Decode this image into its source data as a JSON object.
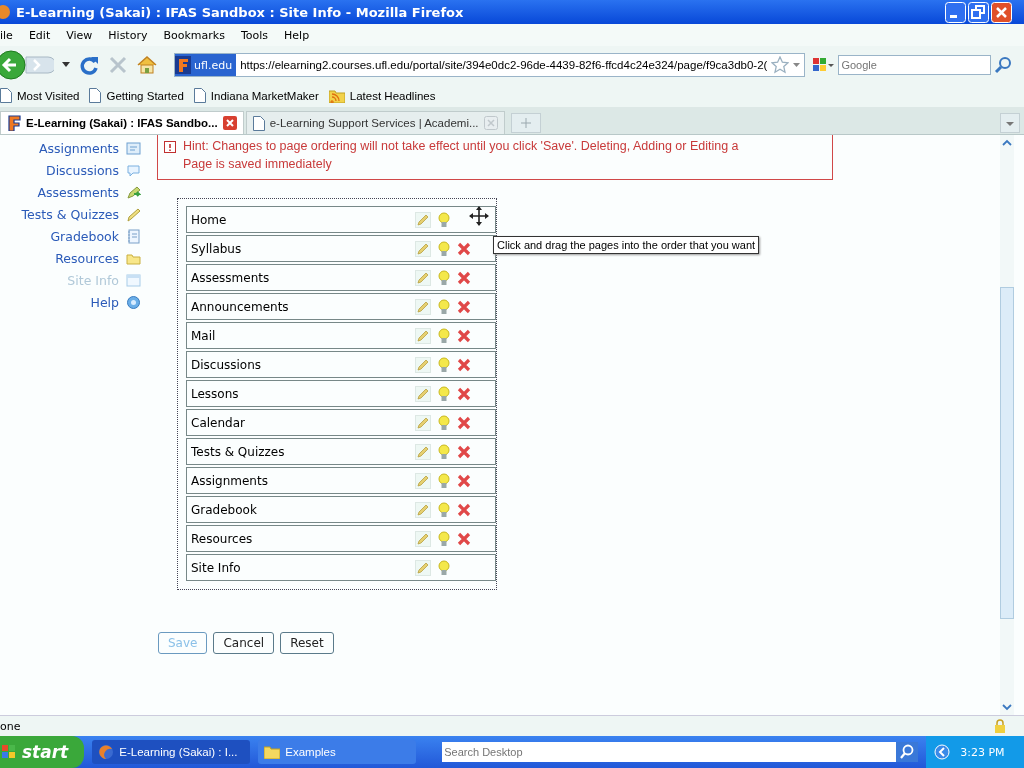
{
  "window": {
    "title": "E-Learning (Sakai) : IFAS Sandbox : Site Info - Mozilla Firefox"
  },
  "menu": [
    "ile",
    "Edit",
    "View",
    "History",
    "Bookmarks",
    "Tools",
    "Help"
  ],
  "address": {
    "site_badge": "ufl.edu",
    "url": "https://elearning2.courses.ufl.edu/portal/site/394e0dc2-96de-4439-82f6-ffcd4c24e324/page/f9ca3db0-2("
  },
  "search": {
    "placeholder": "Google"
  },
  "bookmarks": [
    {
      "label": "Most Visited",
      "kind": "page"
    },
    {
      "label": "Getting Started",
      "kind": "page"
    },
    {
      "label": "Indiana MarketMaker",
      "kind": "page"
    },
    {
      "label": "Latest Headlines",
      "kind": "feed"
    }
  ],
  "tabs": [
    {
      "label": "E-Learning (Sakai) : IFAS Sandbo...",
      "selected": true
    },
    {
      "label": "e-Learning Support Services | Academi...",
      "selected": false
    }
  ],
  "sidebar": {
    "items": [
      {
        "label": "Assignments",
        "selected": false
      },
      {
        "label": "Discussions",
        "selected": false
      },
      {
        "label": "Assessments",
        "selected": false
      },
      {
        "label": "Tests & Quizzes",
        "selected": false
      },
      {
        "label": "Gradebook",
        "selected": false
      },
      {
        "label": "Resources",
        "selected": false
      },
      {
        "label": "Site Info",
        "selected": true
      },
      {
        "label": "Help",
        "selected": false
      }
    ]
  },
  "hint": {
    "lines": [
      "Hint: Changes to page ordering will not take effect until you click 'Save'. Deleting, Adding or Editing a",
      "Page is saved immediately"
    ]
  },
  "pages": [
    {
      "title": "Home",
      "deletable": false
    },
    {
      "title": "Syllabus",
      "deletable": true
    },
    {
      "title": "Assessments",
      "deletable": true
    },
    {
      "title": "Announcements",
      "deletable": true
    },
    {
      "title": "Mail",
      "deletable": true
    },
    {
      "title": "Discussions",
      "deletable": true
    },
    {
      "title": "Lessons",
      "deletable": true
    },
    {
      "title": "Calendar",
      "deletable": true
    },
    {
      "title": "Tests & Quizzes",
      "deletable": true
    },
    {
      "title": "Assignments",
      "deletable": true
    },
    {
      "title": "Gradebook",
      "deletable": true
    },
    {
      "title": "Resources",
      "deletable": true
    },
    {
      "title": "Site Info",
      "deletable": false
    }
  ],
  "tooltip": "Click and drag the pages into the order that you want",
  "buttons": [
    {
      "label": "Save",
      "disabled": true
    },
    {
      "label": "Cancel",
      "disabled": false
    },
    {
      "label": "Reset",
      "disabled": false
    }
  ],
  "status_bar": {
    "text": "one"
  },
  "taskbar": {
    "start": "start",
    "tasks": [
      {
        "label": "E-Learning (Sakai) : I...",
        "kind": "browser",
        "selected": true
      },
      {
        "label": "Examples",
        "kind": "folder",
        "selected": false
      }
    ],
    "search_placeholder": "Search Desktop",
    "clock": "3:23 PM"
  }
}
